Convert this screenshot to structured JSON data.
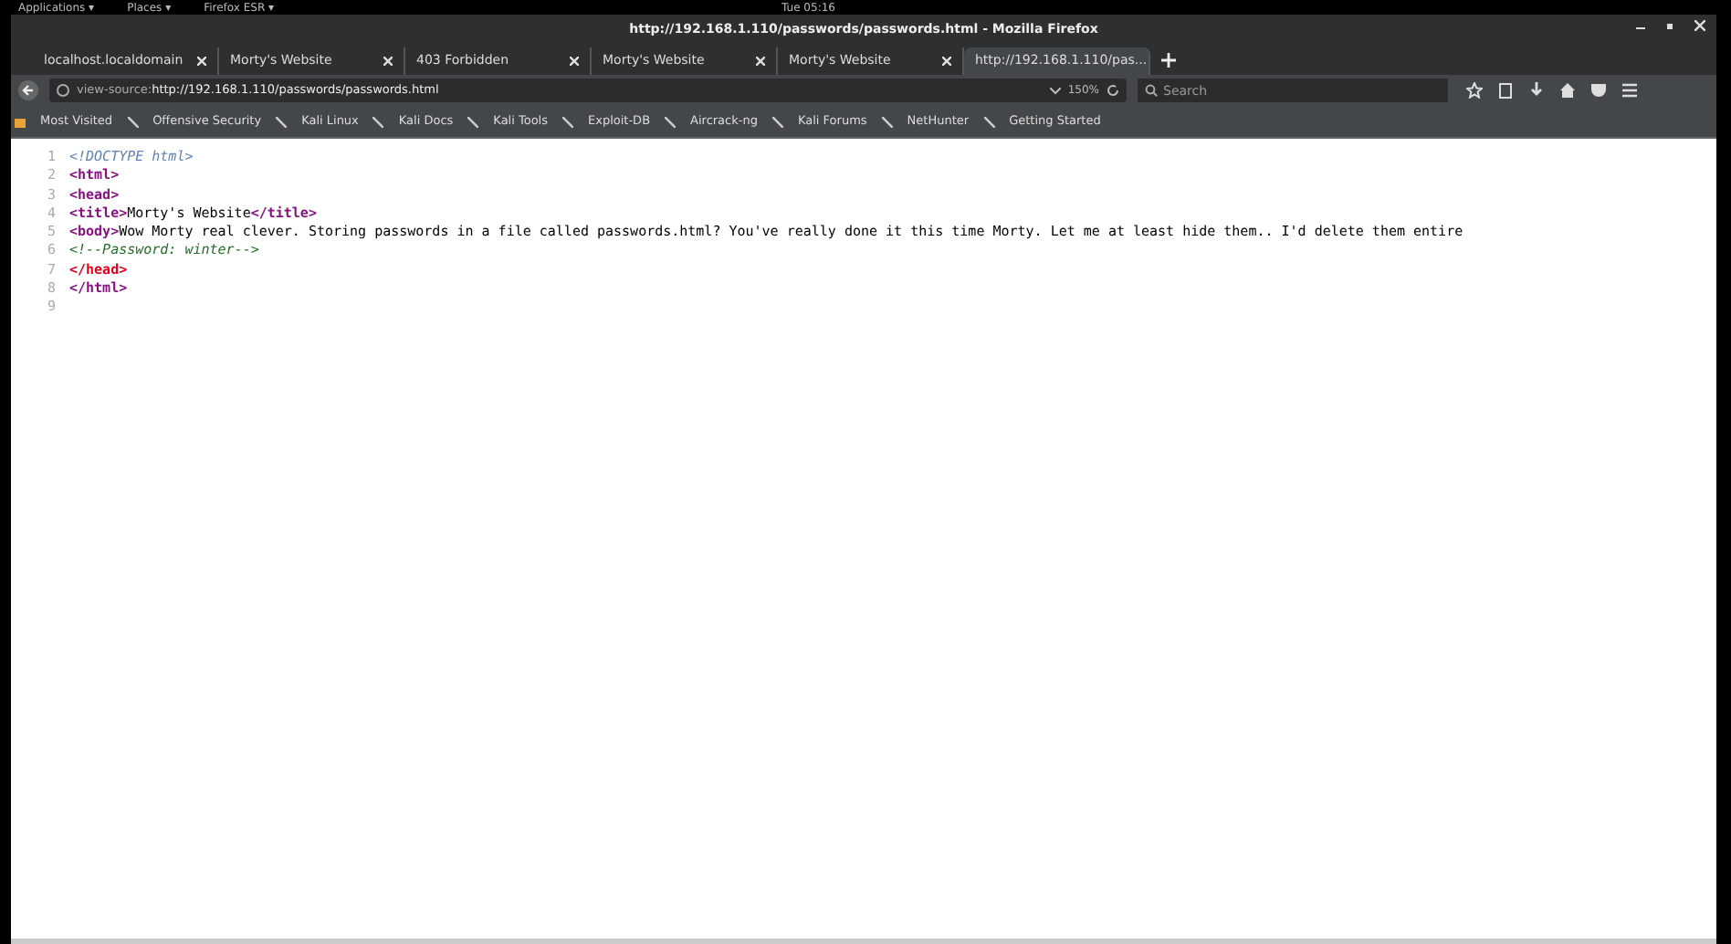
{
  "top_bar": {
    "menus": [
      "Applications ▾",
      "Places ▾",
      "Firefox ESR ▾"
    ],
    "clock": "Tue 05:16"
  },
  "window": {
    "title": "http://192.168.1.110/passwords/passwords.html - Mozilla Firefox"
  },
  "tabs": [
    {
      "label": "localhost.localdomain",
      "selected": false
    },
    {
      "label": "Morty's Website",
      "selected": false
    },
    {
      "label": "403 Forbidden",
      "selected": false
    },
    {
      "label": "Morty's Website",
      "selected": false
    },
    {
      "label": "Morty's Website",
      "selected": false
    },
    {
      "label": "http://192.168.1.110/pas...",
      "selected": true
    }
  ],
  "address": {
    "prefix": "view-source:",
    "url": "http://192.168.1.110/passwords/passwords.html",
    "zoom": "150%"
  },
  "search": {
    "placeholder": "Search"
  },
  "bookmarks": [
    "Most Visited",
    "Offensive Security",
    "Kali Linux",
    "Kali Docs",
    "Kali Tools",
    "Exploit-DB",
    "Aircrack-ng",
    "Kali Forums",
    "NetHunter",
    "Getting Started"
  ],
  "source_lines": [
    {
      "number": "1",
      "segments": [
        {
          "kind": "doctype",
          "text": "<!DOCTYPE html>"
        }
      ]
    },
    {
      "number": "2",
      "segments": [
        {
          "kind": "tag",
          "text": "<html>"
        }
      ]
    },
    {
      "number": "3",
      "segments": [
        {
          "kind": "tag",
          "text": "<head>"
        }
      ]
    },
    {
      "number": "4",
      "segments": [
        {
          "kind": "tag",
          "text": "<title>"
        },
        {
          "kind": "text",
          "text": "Morty's Website"
        },
        {
          "kind": "tag",
          "text": "</title>"
        }
      ]
    },
    {
      "number": "5",
      "segments": [
        {
          "kind": "tag",
          "text": "<body>"
        },
        {
          "kind": "text",
          "text": "Wow Morty real clever. Storing passwords in a file called passwords.html? You've really done it this time Morty. Let me at least hide them.. I'd delete them entire"
        }
      ]
    },
    {
      "number": "6",
      "segments": [
        {
          "kind": "comment",
          "text": "<!--Password: winter-->"
        }
      ]
    },
    {
      "number": "7",
      "segments": [
        {
          "kind": "error",
          "text": "</head>"
        }
      ]
    },
    {
      "number": "8",
      "segments": [
        {
          "kind": "tag",
          "text": "</html>"
        }
      ]
    },
    {
      "number": "9"
    }
  ]
}
